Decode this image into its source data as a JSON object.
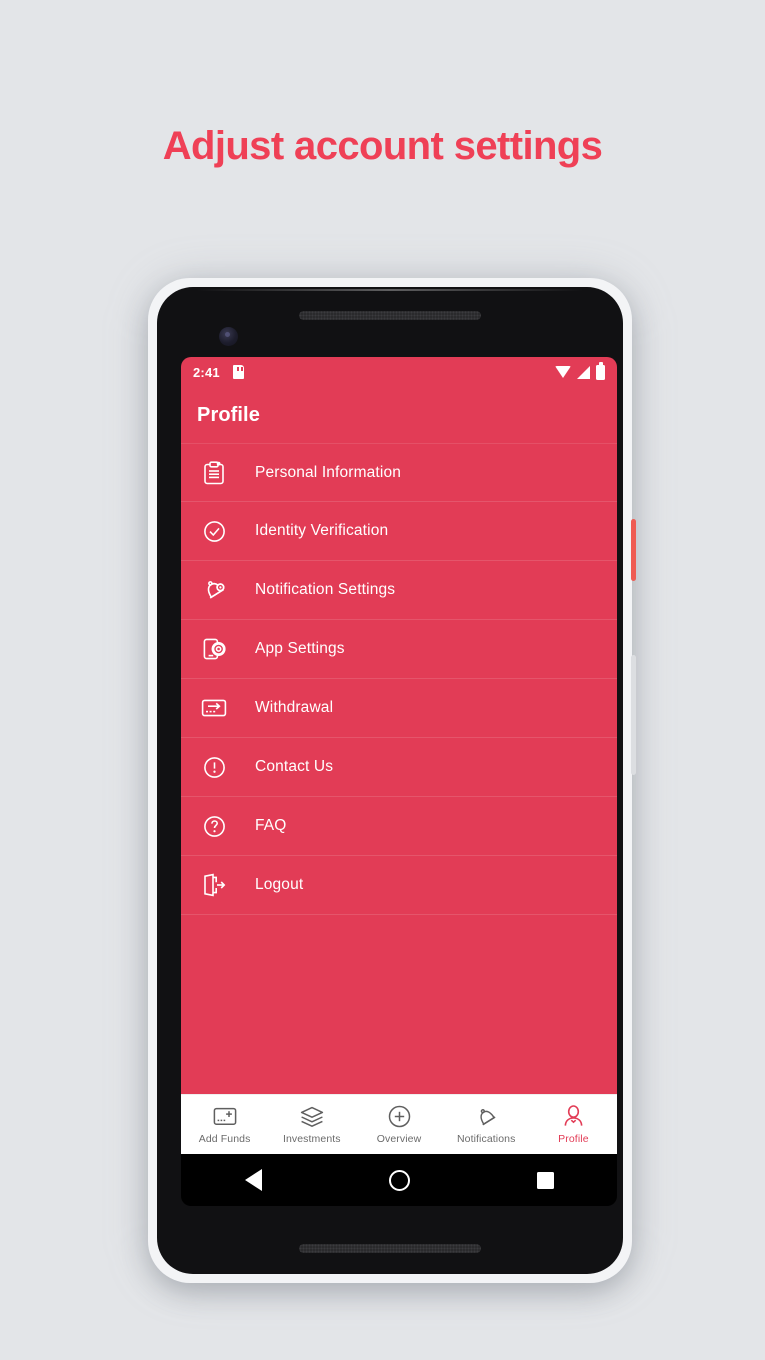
{
  "headline": "Adjust account settings",
  "colors": {
    "accent": "#ef4056",
    "app_background": "#e23c56",
    "page_background": "#e3e5e8",
    "nav_inactive": "#6b6b6b",
    "power_button": "#ef5b52"
  },
  "status_bar": {
    "time": "2:41",
    "icons_left": [
      "sd-card-icon"
    ],
    "icons_right": [
      "wifi-icon",
      "cellular-signal-icon",
      "battery-icon"
    ]
  },
  "app_bar": {
    "title": "Profile"
  },
  "menu": {
    "items": [
      {
        "label": "Personal Information",
        "icon": "clipboard-icon"
      },
      {
        "label": "Identity Verification",
        "icon": "check-circle-icon"
      },
      {
        "label": "Notification Settings",
        "icon": "bell-icon"
      },
      {
        "label": "App Settings",
        "icon": "phone-gear-icon"
      },
      {
        "label": "Withdrawal",
        "icon": "card-arrow-out-icon"
      },
      {
        "label": "Contact Us",
        "icon": "exclamation-circle-icon"
      },
      {
        "label": "FAQ",
        "icon": "question-circle-icon"
      },
      {
        "label": "Logout",
        "icon": "logout-door-icon"
      }
    ]
  },
  "bottom_nav": {
    "items": [
      {
        "label": "Add Funds",
        "icon": "card-plus-icon",
        "active": false
      },
      {
        "label": "Investments",
        "icon": "layers-icon",
        "active": false
      },
      {
        "label": "Overview",
        "icon": "plus-circle-icon",
        "active": false
      },
      {
        "label": "Notifications",
        "icon": "bell-outline-icon",
        "active": false
      },
      {
        "label": "Profile",
        "icon": "person-icon",
        "active": true
      }
    ]
  },
  "android_nav": {
    "back": "back-triangle-icon",
    "home": "home-circle-icon",
    "recents": "recents-square-icon"
  }
}
